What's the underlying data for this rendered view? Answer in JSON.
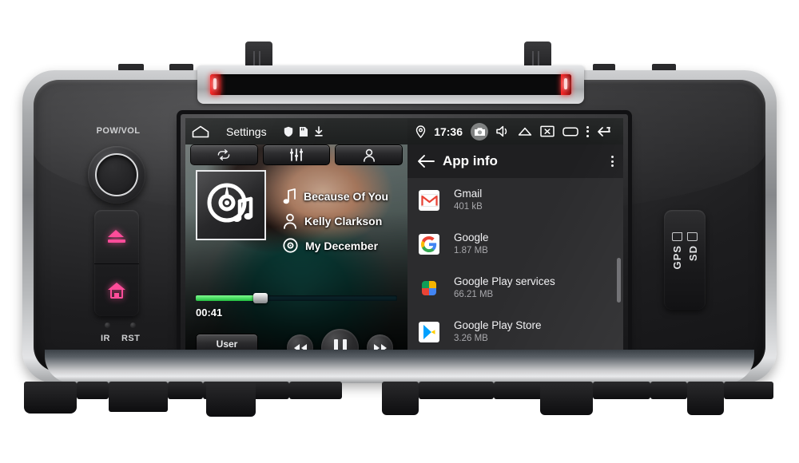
{
  "device": {
    "brand_panel_labels": {
      "power_volume": "POW/VOL",
      "ir": "IR",
      "rst": "RST",
      "gps": "GPS",
      "sd": "SD"
    },
    "buttons": {
      "eject": "eject-button",
      "home": "home-button"
    },
    "accent_color": "#ff4d9a",
    "bezel_color": "#a9abad",
    "cd_slot_led_color": "#ff2a2a"
  },
  "screen": {
    "status_bar": {
      "home_icon": "home-icon",
      "title": "Settings",
      "shield_icon": "shield-icon",
      "sdcard_icon": "sd-card-icon",
      "download_icon": "download-icon",
      "location_icon": "location-pin-icon",
      "clock": "17:36",
      "camera_icon": "camera-icon",
      "volume_icon": "speaker-icon",
      "eject_icon": "eject-icon",
      "screenshot_icon": "screenshot-icon",
      "recents_icon": "recents-icon",
      "overflow_icon": "overflow-menu-icon",
      "back_icon": "back-arrow-icon"
    },
    "media_player": {
      "segment_buttons": [
        {
          "name": "repeat-button",
          "icon": "repeat-icon"
        },
        {
          "name": "equalizer-button",
          "icon": "equalizer-icon"
        },
        {
          "name": "user-profile-button",
          "icon": "person-icon"
        }
      ],
      "album_art_icon": "disc-music-icon",
      "track": {
        "title": "Because Of You",
        "artist": "Kelly Clarkson",
        "album": "My December",
        "title_icon": "music-note-icon",
        "artist_icon": "person-icon",
        "album_icon": "disc-icon"
      },
      "elapsed_time": "00:41",
      "progress_percent": 30,
      "progress_color": "#22c03f",
      "user_button_label": "User",
      "transport": {
        "previous": "rewind-button",
        "play_pause": "pause-button",
        "next": "fast-forward-button"
      }
    },
    "settings_panel": {
      "back_icon": "back-arrow-icon",
      "title": "App info",
      "overflow_icon": "overflow-menu-icon",
      "apps": [
        {
          "name": "Gmail",
          "size": "401 kB",
          "icon": "gmail-icon"
        },
        {
          "name": "Google",
          "size": "1.87 MB",
          "icon": "google-icon"
        },
        {
          "name": "Google Play services",
          "size": "66.21 MB",
          "icon": "play-services-icon"
        },
        {
          "name": "Google Play Store",
          "size": "3.26 MB",
          "icon": "play-store-icon"
        }
      ]
    }
  }
}
